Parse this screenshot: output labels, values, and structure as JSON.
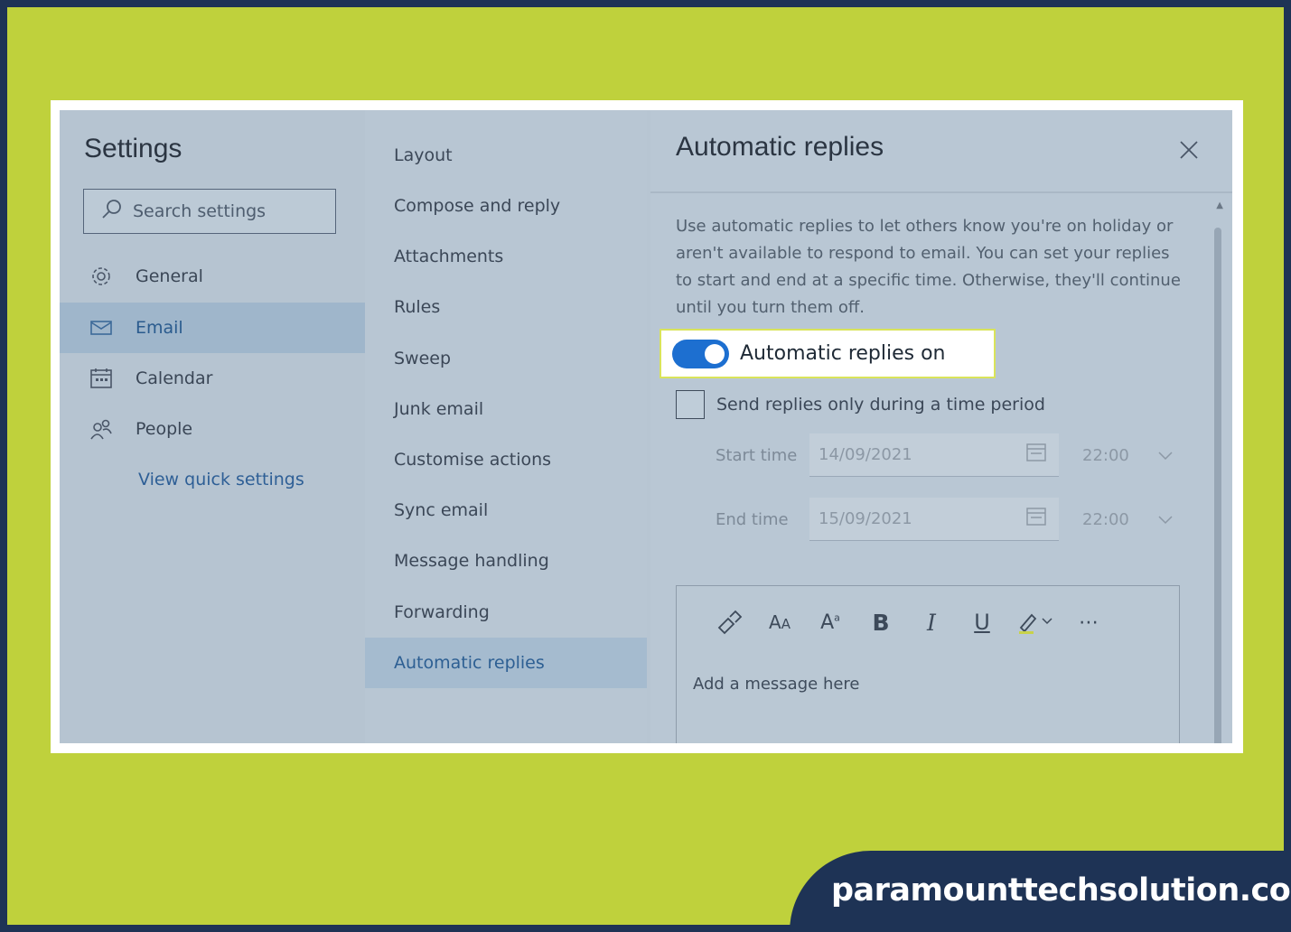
{
  "settings": {
    "title": "Settings",
    "search_placeholder": "Search settings",
    "nav": [
      {
        "label": "General",
        "icon": "gear-icon"
      },
      {
        "label": "Email",
        "icon": "mail-icon",
        "active": true
      },
      {
        "label": "Calendar",
        "icon": "calendar-icon"
      },
      {
        "label": "People",
        "icon": "people-icon"
      }
    ],
    "quick_settings_link": "View quick settings"
  },
  "email_menu": {
    "items": [
      "Layout",
      "Compose and reply",
      "Attachments",
      "Rules",
      "Sweep",
      "Junk email",
      "Customise actions",
      "Sync email",
      "Message handling",
      "Forwarding",
      "Automatic replies"
    ],
    "active": "Automatic replies"
  },
  "panel": {
    "title": "Automatic replies",
    "description": "Use automatic replies to let others know you're on holiday or aren't available to respond to email. You can set your replies to start and end at a specific time. Otherwise, they'll continue until you turn them off.",
    "toggle_label": "Automatic replies on",
    "toggle_on": true,
    "checkbox_label": "Send replies only during a time period",
    "checkbox_checked": false,
    "start_label": "Start time",
    "start_date": "14/09/2021",
    "start_hour": "22:00",
    "end_label": "End time",
    "end_date": "15/09/2021",
    "end_hour": "22:00",
    "message_placeholder": "Add a message here",
    "toolbar": [
      "format-painter-icon",
      "font-size-icon",
      "superscript-icon",
      "bold-icon",
      "italic-icon",
      "underline-icon",
      "highlight-icon",
      "more-icon"
    ]
  },
  "colors": {
    "accent": "#1d6fd0",
    "lime": "#bfd13c",
    "navy": "#1e3355"
  },
  "watermark": "paramounttechsolution.com"
}
